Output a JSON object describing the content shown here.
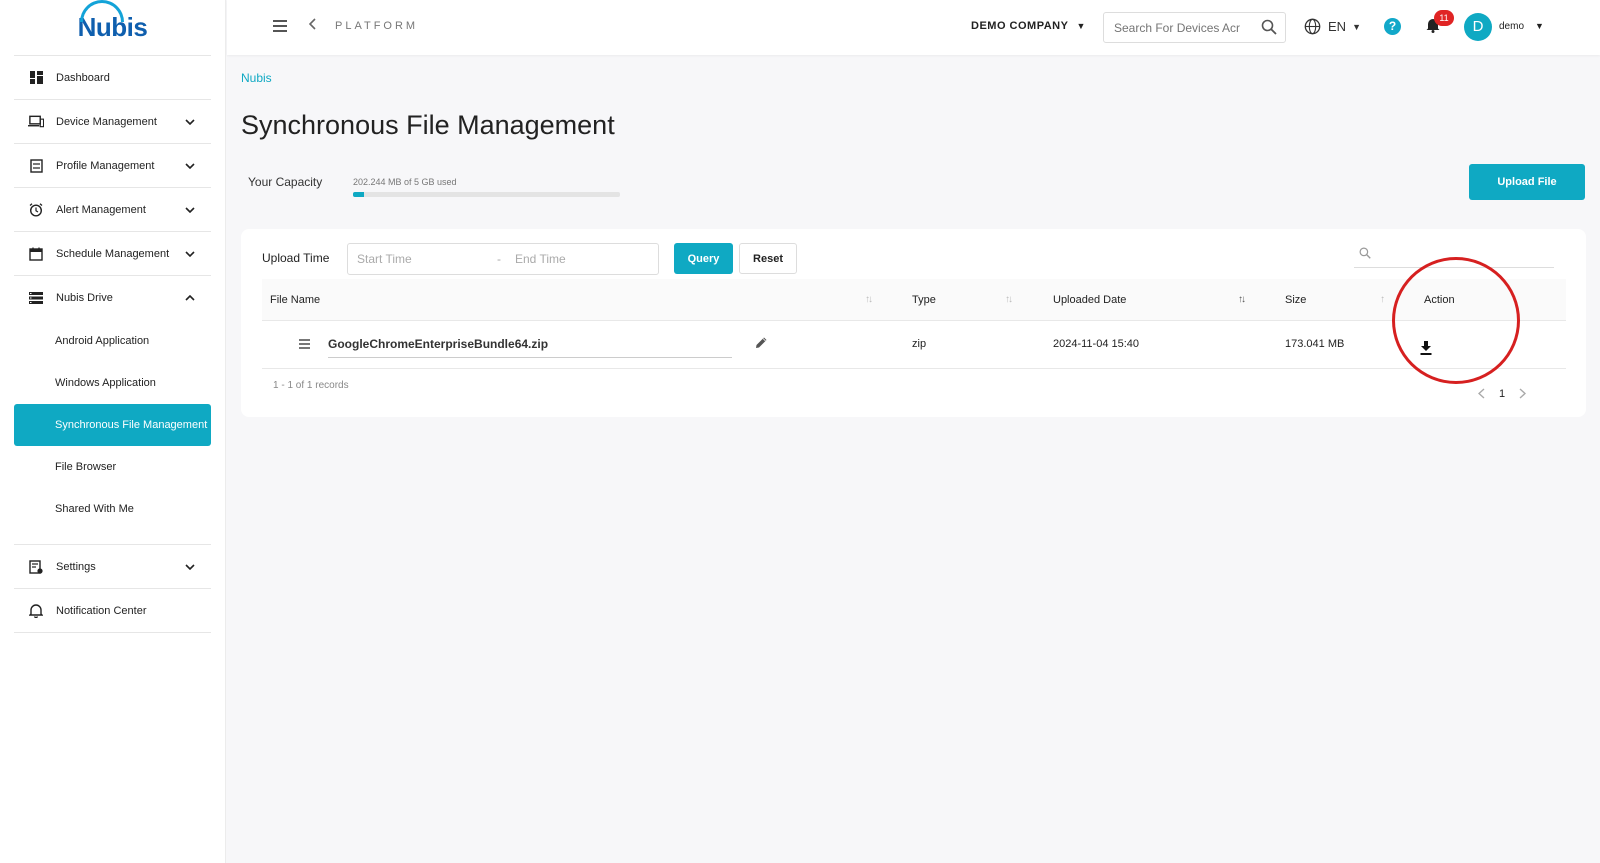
{
  "app": {
    "logo": "Nubis"
  },
  "sidebar": {
    "items": [
      {
        "label": "Dashboard",
        "icon": "dashboard-icon"
      },
      {
        "label": "Device Management",
        "icon": "devices-icon"
      },
      {
        "label": "Profile Management",
        "icon": "profile-icon"
      },
      {
        "label": "Alert Management",
        "icon": "alarm-icon"
      },
      {
        "label": "Schedule Management",
        "icon": "calendar-icon"
      },
      {
        "label": "Nubis Drive",
        "icon": "drive-icon"
      },
      {
        "label": "Settings",
        "icon": "settings-icon"
      },
      {
        "label": "Notification Center",
        "icon": "bell-icon"
      }
    ],
    "drive_sub": [
      {
        "label": "Android Application"
      },
      {
        "label": "Windows Application"
      },
      {
        "label": "Synchronous File Management"
      },
      {
        "label": "File Browser"
      },
      {
        "label": "Shared With Me"
      }
    ]
  },
  "header": {
    "platform": "PLATFORM",
    "company": "DEMO COMPANY",
    "search_placeholder": "Search For Devices Acr",
    "lang": "EN",
    "help": "?",
    "notifications": "11",
    "avatar": "D",
    "user": "demo"
  },
  "main": {
    "breadcrumb": "Nubis",
    "title": "Synchronous File Management",
    "capacity_label": "Your Capacity",
    "capacity_text": "202.244 MB of 5 GB used",
    "capacity_fraction": 0.04,
    "upload_button": "Upload File"
  },
  "filter": {
    "upload_time_label": "Upload Time",
    "start_placeholder": "Start Time",
    "separator": "-",
    "end_placeholder": "End Time",
    "query": "Query",
    "reset": "Reset"
  },
  "table": {
    "columns": [
      "File Name",
      "Type",
      "Uploaded Date",
      "Size",
      "Action"
    ],
    "rows": [
      {
        "name": "GoogleChromeEnterpriseBundle64.zip",
        "type": "zip",
        "date": "2024-11-04 15:40",
        "size": "173.041 MB"
      }
    ],
    "records": "1 - 1 of 1 records",
    "page": "1"
  },
  "colors": {
    "accent": "#0fa9c3",
    "highlight": "#d62020",
    "badge": "#e02424"
  }
}
